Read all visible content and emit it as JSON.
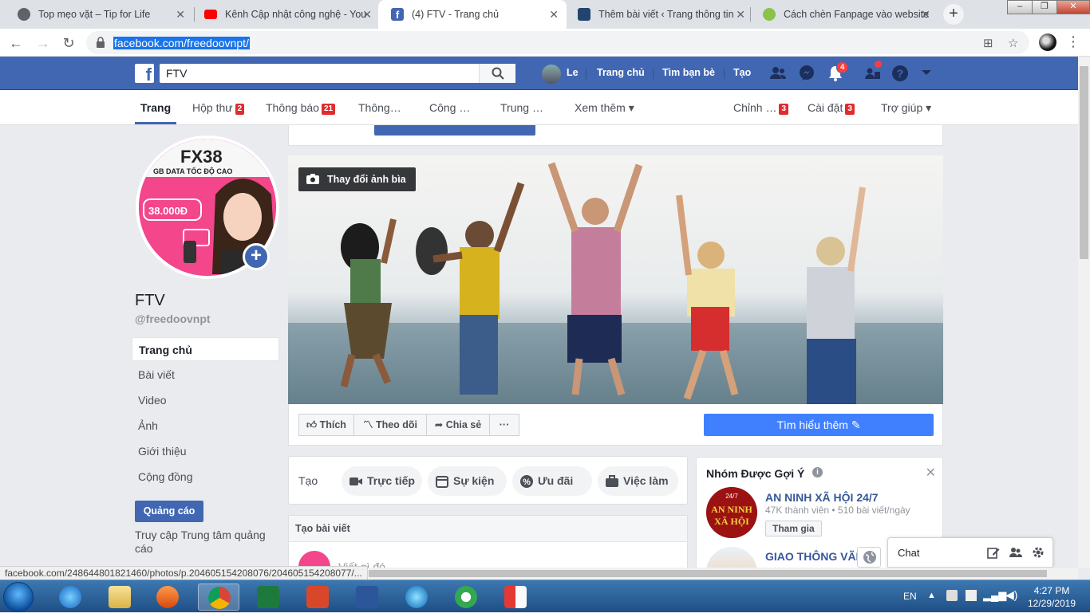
{
  "browser": {
    "tabs": [
      {
        "title": "Top mẹo vặt – Tip for Life",
        "favicon": "globe-icon",
        "active": false
      },
      {
        "title": "Kênh Cập nhật công nghệ - You",
        "favicon": "youtube-icon",
        "active": false
      },
      {
        "title": "(4) FTV - Trang chủ",
        "favicon": "facebook-icon",
        "active": true
      },
      {
        "title": "Thêm bài viết ‹ Trang thông tin",
        "favicon": "wordpress-icon",
        "active": false
      },
      {
        "title": "Cách chèn Fanpage vào website",
        "favicon": "site-icon",
        "active": false
      }
    ],
    "url": "facebook.com/freedoovnpt/",
    "status_url": "facebook.com/248644801821460/photos/p.204605154208076/204605154208077/..."
  },
  "fb_header": {
    "search_value": "FTV",
    "user_name": "Le",
    "nav": [
      "Trang chủ",
      "Tìm bạn bè",
      "Tạo"
    ],
    "notification_count": "4"
  },
  "page_tabs": {
    "items": [
      {
        "label": "Trang",
        "badge": ""
      },
      {
        "label": "Hộp thư",
        "badge": "2"
      },
      {
        "label": "Thông báo",
        "badge": "21"
      },
      {
        "label": "Thông…",
        "badge": ""
      },
      {
        "label": "Công …",
        "badge": ""
      },
      {
        "label": "Trung …",
        "badge": ""
      },
      {
        "label": "Xem thêm ▾",
        "badge": ""
      }
    ],
    "right": [
      {
        "label": "Chỉnh …",
        "badge": "3"
      },
      {
        "label": "Cài đặt",
        "badge": "3"
      },
      {
        "label": "Trợ giúp ▾",
        "badge": ""
      }
    ]
  },
  "page": {
    "name": "FTV",
    "handle": "@freedoovnpt",
    "left_nav": [
      "Trang chủ",
      "Bài viết",
      "Video",
      "Ảnh",
      "Giới thiệu",
      "Cộng đồng"
    ],
    "ads_button": "Quảng cáo",
    "ads_link": "Truy cập Trung tâm quảng cáo",
    "profile_pic": {
      "headline": "FX38",
      "subline": "GB DATA TỐC ĐỘ CAO",
      "price": "38.000Đ"
    }
  },
  "cover": {
    "change_button": "Thay đổi ảnh bìa",
    "actions": [
      "Thích",
      "Theo dõi",
      "Chia sẻ",
      "···"
    ],
    "learn_more": "Tìm hiểu thêm"
  },
  "create": {
    "label": "Tạo",
    "pills": [
      "Trực tiếp",
      "Sự kiện",
      "Ưu đãi",
      "Việc làm"
    ]
  },
  "post_box": {
    "header": "Tạo bài viết",
    "placeholder": "Viết gì đó..."
  },
  "groups": {
    "title": "Nhóm Được Gợi Ý",
    "items": [
      {
        "name": "AN NINH XÃ HỘI 24/7",
        "meta": "47K thành viên • 510 bài viết/ngày",
        "join": "Tham gia",
        "pic_top": "24/7",
        "pic_line1": "AN NINH",
        "pic_line2": "XÃ HỘI"
      },
      {
        "name": "GIAO THÔNG VÃI N",
        "meta": "",
        "join": "",
        "pic_top": "",
        "pic_line1": "",
        "pic_line2": ""
      }
    ]
  },
  "chat": {
    "label": "Chat"
  },
  "taskbar": {
    "lang": "EN",
    "time": "4:27 PM",
    "date": "12/29/2019"
  },
  "colors": {
    "fb_blue": "#4267b2",
    "cta_blue": "#4080ff",
    "badge_red": "#fa3e3e",
    "page_bg": "#e9ebee"
  }
}
